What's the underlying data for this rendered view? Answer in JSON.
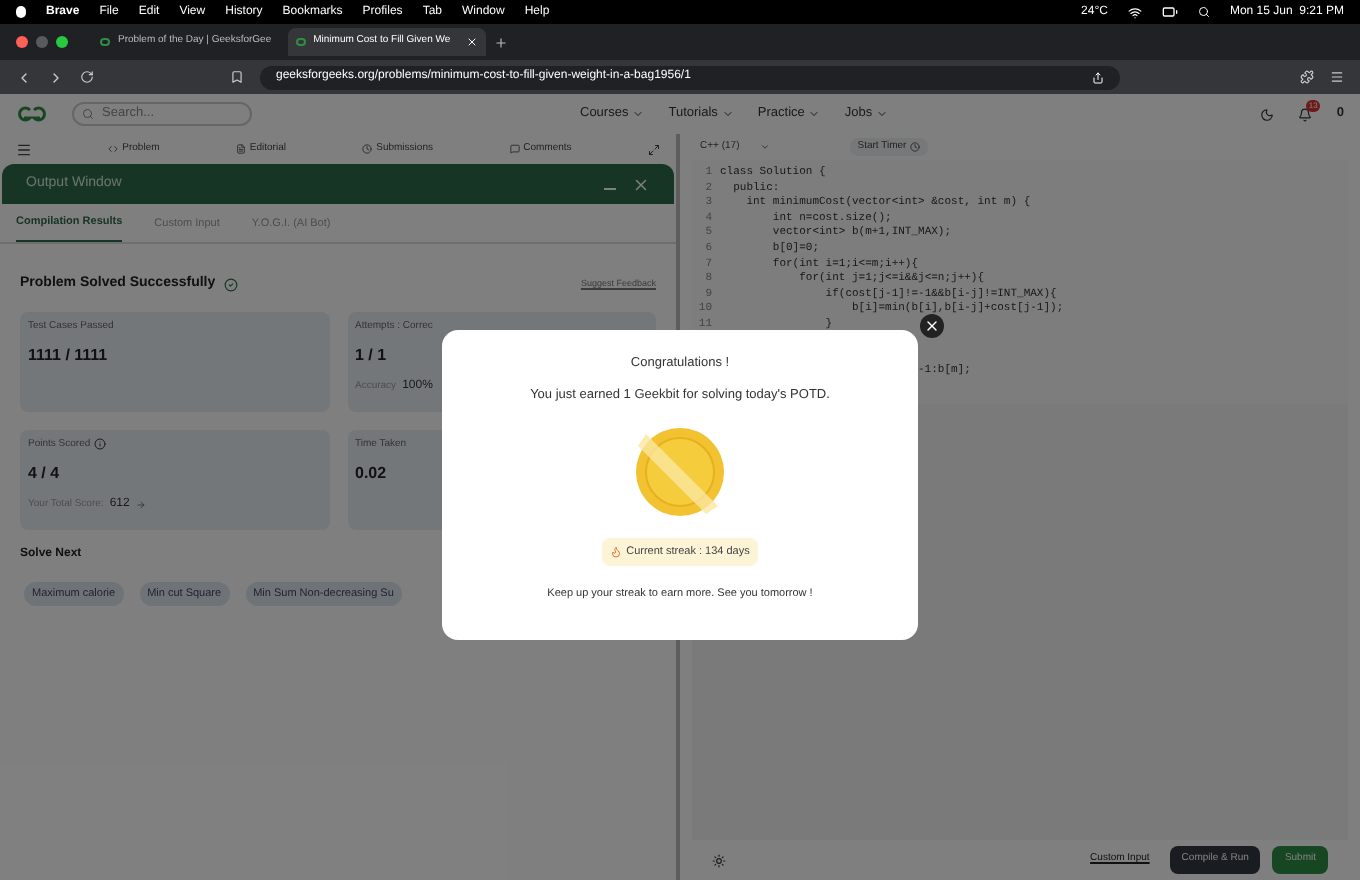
{
  "menubar": {
    "app": "Brave",
    "menus": [
      "File",
      "Edit",
      "View",
      "History",
      "Bookmarks",
      "Profiles",
      "Tab",
      "Window",
      "Help"
    ],
    "weather": "24°C",
    "clock": "Mon 15 Jun  9:21 PM"
  },
  "tabs": [
    {
      "title": "Problem of the Day | GeeksforGee",
      "selected": false
    },
    {
      "title": "Minimum Cost to Fill Given We",
      "selected": true
    }
  ],
  "address": {
    "url": "geeksforgeeks.org/problems/minimum-cost-to-fill-given-weight-in-a-bag1956/1"
  },
  "site_header": {
    "search_placeholder": "Search...",
    "nav": [
      "Courses",
      "Tutorials",
      "Practice",
      "Jobs"
    ],
    "badge": "13",
    "count": "0"
  },
  "problem_tabs": [
    "Problem",
    "Editorial",
    "Submissions",
    "Comments"
  ],
  "output_window": {
    "title": "Output Window",
    "tabs": [
      {
        "label": "Compilation Results",
        "selected": true
      },
      {
        "label": "Custom Input",
        "selected": false
      },
      {
        "label": "Y.O.G.I. (AI Bot)",
        "selected": false
      }
    ],
    "status": "Problem Solved Successfully",
    "feedback_link": "Suggest Feedback",
    "stats": [
      {
        "label": "Test Cases Passed",
        "value": "1111 / 1111"
      },
      {
        "label": "Attempts : Correc",
        "value": "1 / 1",
        "note_label": "Accuracy",
        "note_value": "100%"
      },
      {
        "label": "Points Scored",
        "value": "4 / 4",
        "note_label": "Your Total Score:",
        "note_value": "612"
      },
      {
        "label": "Time Taken",
        "value": "0.02"
      }
    ],
    "solve_next": {
      "title": "Solve Next",
      "items": [
        "Maximum calorie",
        "Min cut Square",
        "Min Sum Non-decreasing Su"
      ]
    }
  },
  "editor": {
    "language": "C++ (17)",
    "timer": "Start Timer",
    "lines": [
      {
        "number": "1",
        "text": "class Solution {"
      },
      {
        "number": "2",
        "text": "  public:"
      },
      {
        "number": "3",
        "text": "    int minimumCost(vector<int> &cost, int m) {"
      },
      {
        "number": "4",
        "text": "        int n=cost.size();"
      },
      {
        "number": "5",
        "text": "        vector<int> b(m+1,INT_MAX);"
      },
      {
        "number": "6",
        "text": "        b[0]=0;"
      },
      {
        "number": "7",
        "text": "        for(int i=1;i<=m;i++){"
      },
      {
        "number": "8",
        "text": "            for(int j=1;j<=i&&j<=n;j++){"
      },
      {
        "number": "9",
        "text": "                if(cost[j-1]!=-1&&b[i-j]!=INT_MAX){"
      },
      {
        "number": "10",
        "text": "                    b[i]=min(b[i],b[i-j]+cost[j-1]);"
      },
      {
        "number": "11",
        "text": "                }"
      }
    ],
    "partial_line": "-1:b[m];",
    "custom_input": "Custom Input",
    "buttons": [
      {
        "label": "Compile & Run",
        "kind": "secondary"
      },
      {
        "label": "Submit",
        "kind": "primary"
      }
    ]
  },
  "modal": {
    "title": "Congratulations !",
    "message": "You just earned 1 Geekbit for solving today's POTD.",
    "streak": "Current streak : 134 days",
    "footer": "Keep up your streak to earn more. See you tomorrow !"
  }
}
